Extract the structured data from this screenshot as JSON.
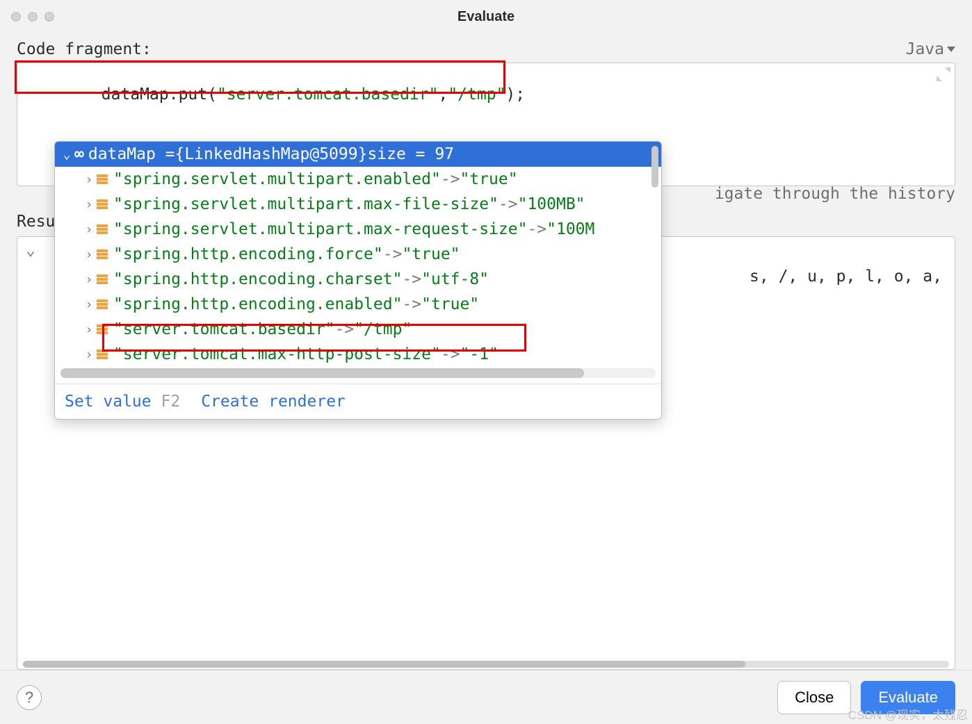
{
  "window": {
    "title": "Evaluate"
  },
  "labels": {
    "code_fragment": "Code fragment:",
    "language": "Java",
    "hint_suffix": "igate through the history",
    "result": "Resu"
  },
  "code": {
    "prefix": "dataMap",
    "method": ".put",
    "open": "(",
    "arg1": "\"server.tomcat.basedir\"",
    "comma": ",",
    "arg2": "\"/tmp\"",
    "close": ")",
    "semi": ";"
  },
  "result_preview": "s, /, u, p, l, o, a,",
  "popup": {
    "root_prefix": "dataMap = ",
    "root_type": "{LinkedHashMap@5099}",
    "root_size_label": "  size = 97",
    "entries": [
      {
        "key": "\"spring.servlet.multipart.enabled\"",
        "val": "\"true\""
      },
      {
        "key": "\"spring.servlet.multipart.max-file-size\"",
        "val": "\"100MB\""
      },
      {
        "key": "\"spring.servlet.multipart.max-request-size\"",
        "val": "\"100M"
      },
      {
        "key": "\"spring.http.encoding.force\"",
        "val": "\"true\""
      },
      {
        "key": "\"spring.http.encoding.charset\"",
        "val": "\"utf-8\""
      },
      {
        "key": "\"spring.http.encoding.enabled\"",
        "val": "\"true\""
      },
      {
        "key": "\"server.tomcat.basedir\"",
        "val": "\"/tmp\""
      },
      {
        "key": "\"server.tomcat.max-http-post-size\"",
        "val": "\"-1\""
      }
    ],
    "set_value": "Set value",
    "set_value_shortcut": "F2",
    "create_renderer": "Create renderer"
  },
  "buttons": {
    "close": "Close",
    "evaluate": "Evaluate"
  },
  "watermark": "CSDN @现实，太残忍"
}
